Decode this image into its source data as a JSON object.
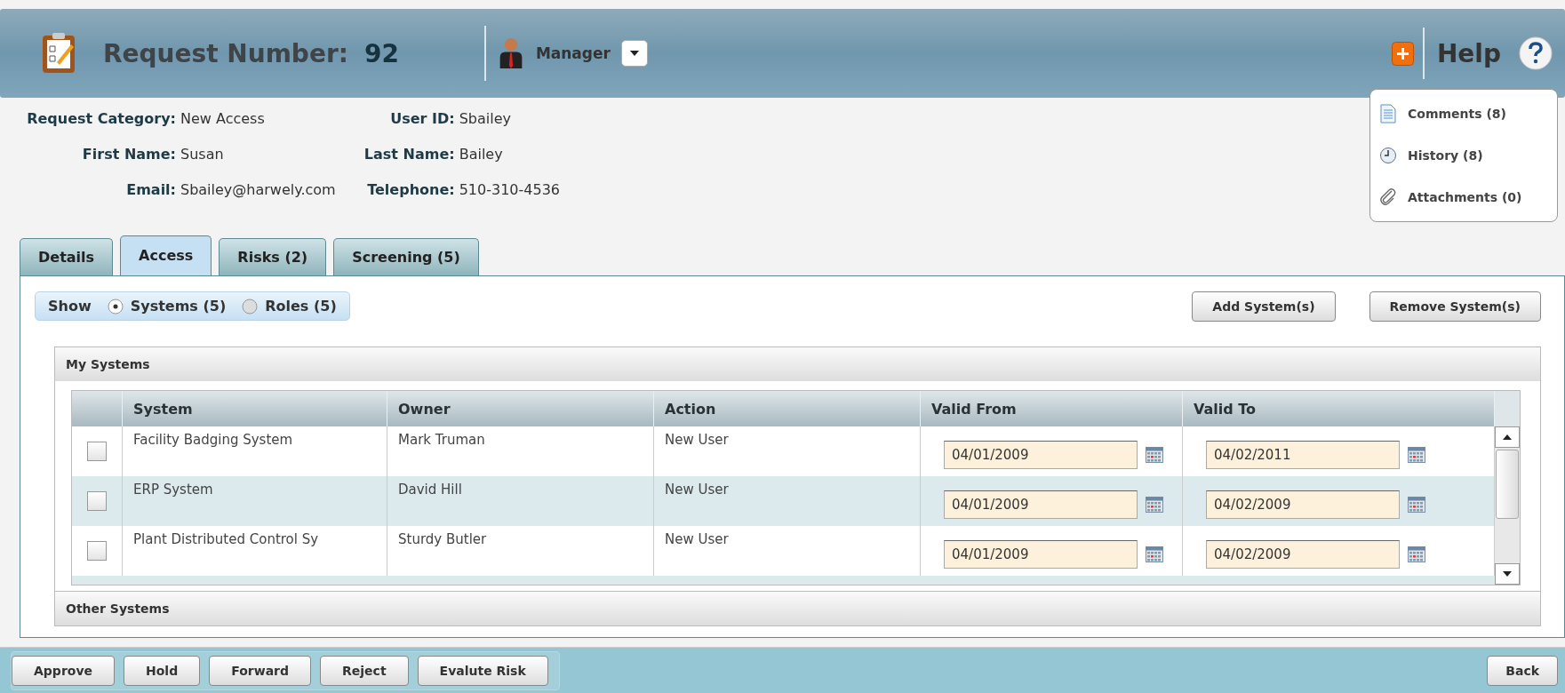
{
  "header": {
    "title": "Request Number:",
    "number": "92",
    "role": "Manager",
    "help": "Help"
  },
  "info": [
    {
      "label": "Request Category:",
      "value": "New Access"
    },
    {
      "label": "User ID:",
      "value": "Sbailey"
    },
    {
      "label": "First Name:",
      "value": "Susan"
    },
    {
      "label": "Last Name:",
      "value": "Bailey"
    },
    {
      "label": "Email:",
      "value": "Sbailey@harwely.com"
    },
    {
      "label": "Telephone:",
      "value": "510-310-4536"
    }
  ],
  "side_links": [
    {
      "kind": "comments",
      "label": "Comments (8)"
    },
    {
      "kind": "history",
      "label": "History (8)"
    },
    {
      "kind": "attachments",
      "label": "Attachments (0)"
    }
  ],
  "tabs": [
    {
      "label": "Details",
      "selected": false
    },
    {
      "label": "Access",
      "selected": true
    },
    {
      "label": "Risks (2)",
      "selected": false
    },
    {
      "label": "Screening (5)",
      "selected": false
    }
  ],
  "show": {
    "label": "Show",
    "options": [
      {
        "label": "Systems (5)",
        "selected": true
      },
      {
        "label": "Roles (5)",
        "selected": false
      }
    ]
  },
  "actions": [
    "Add System(s)",
    "Remove System(s)"
  ],
  "my_systems": {
    "title": "My Systems",
    "columns": [
      "System",
      "Owner",
      "Action",
      "Valid From",
      "Valid To"
    ],
    "rows": [
      {
        "checked": false,
        "system": "Facility Badging System",
        "owner": "Mark Truman",
        "action": "New User",
        "valid_from": "04/01/2009",
        "valid_to": "04/02/2011"
      },
      {
        "checked": false,
        "system": "ERP System",
        "owner": "David Hill",
        "action": "New User",
        "valid_from": "04/01/2009",
        "valid_to": "04/02/2009"
      },
      {
        "checked": false,
        "system": "Plant Distributed Control Sy",
        "owner": "Sturdy Butler",
        "action": "New User",
        "valid_from": "04/01/2009",
        "valid_to": "04/02/2009"
      }
    ]
  },
  "other_systems": {
    "title": "Other Systems"
  },
  "footer": {
    "buttons": [
      "Approve",
      "Hold",
      "Forward",
      "Reject",
      "Evalute Risk"
    ],
    "back": "Back"
  }
}
